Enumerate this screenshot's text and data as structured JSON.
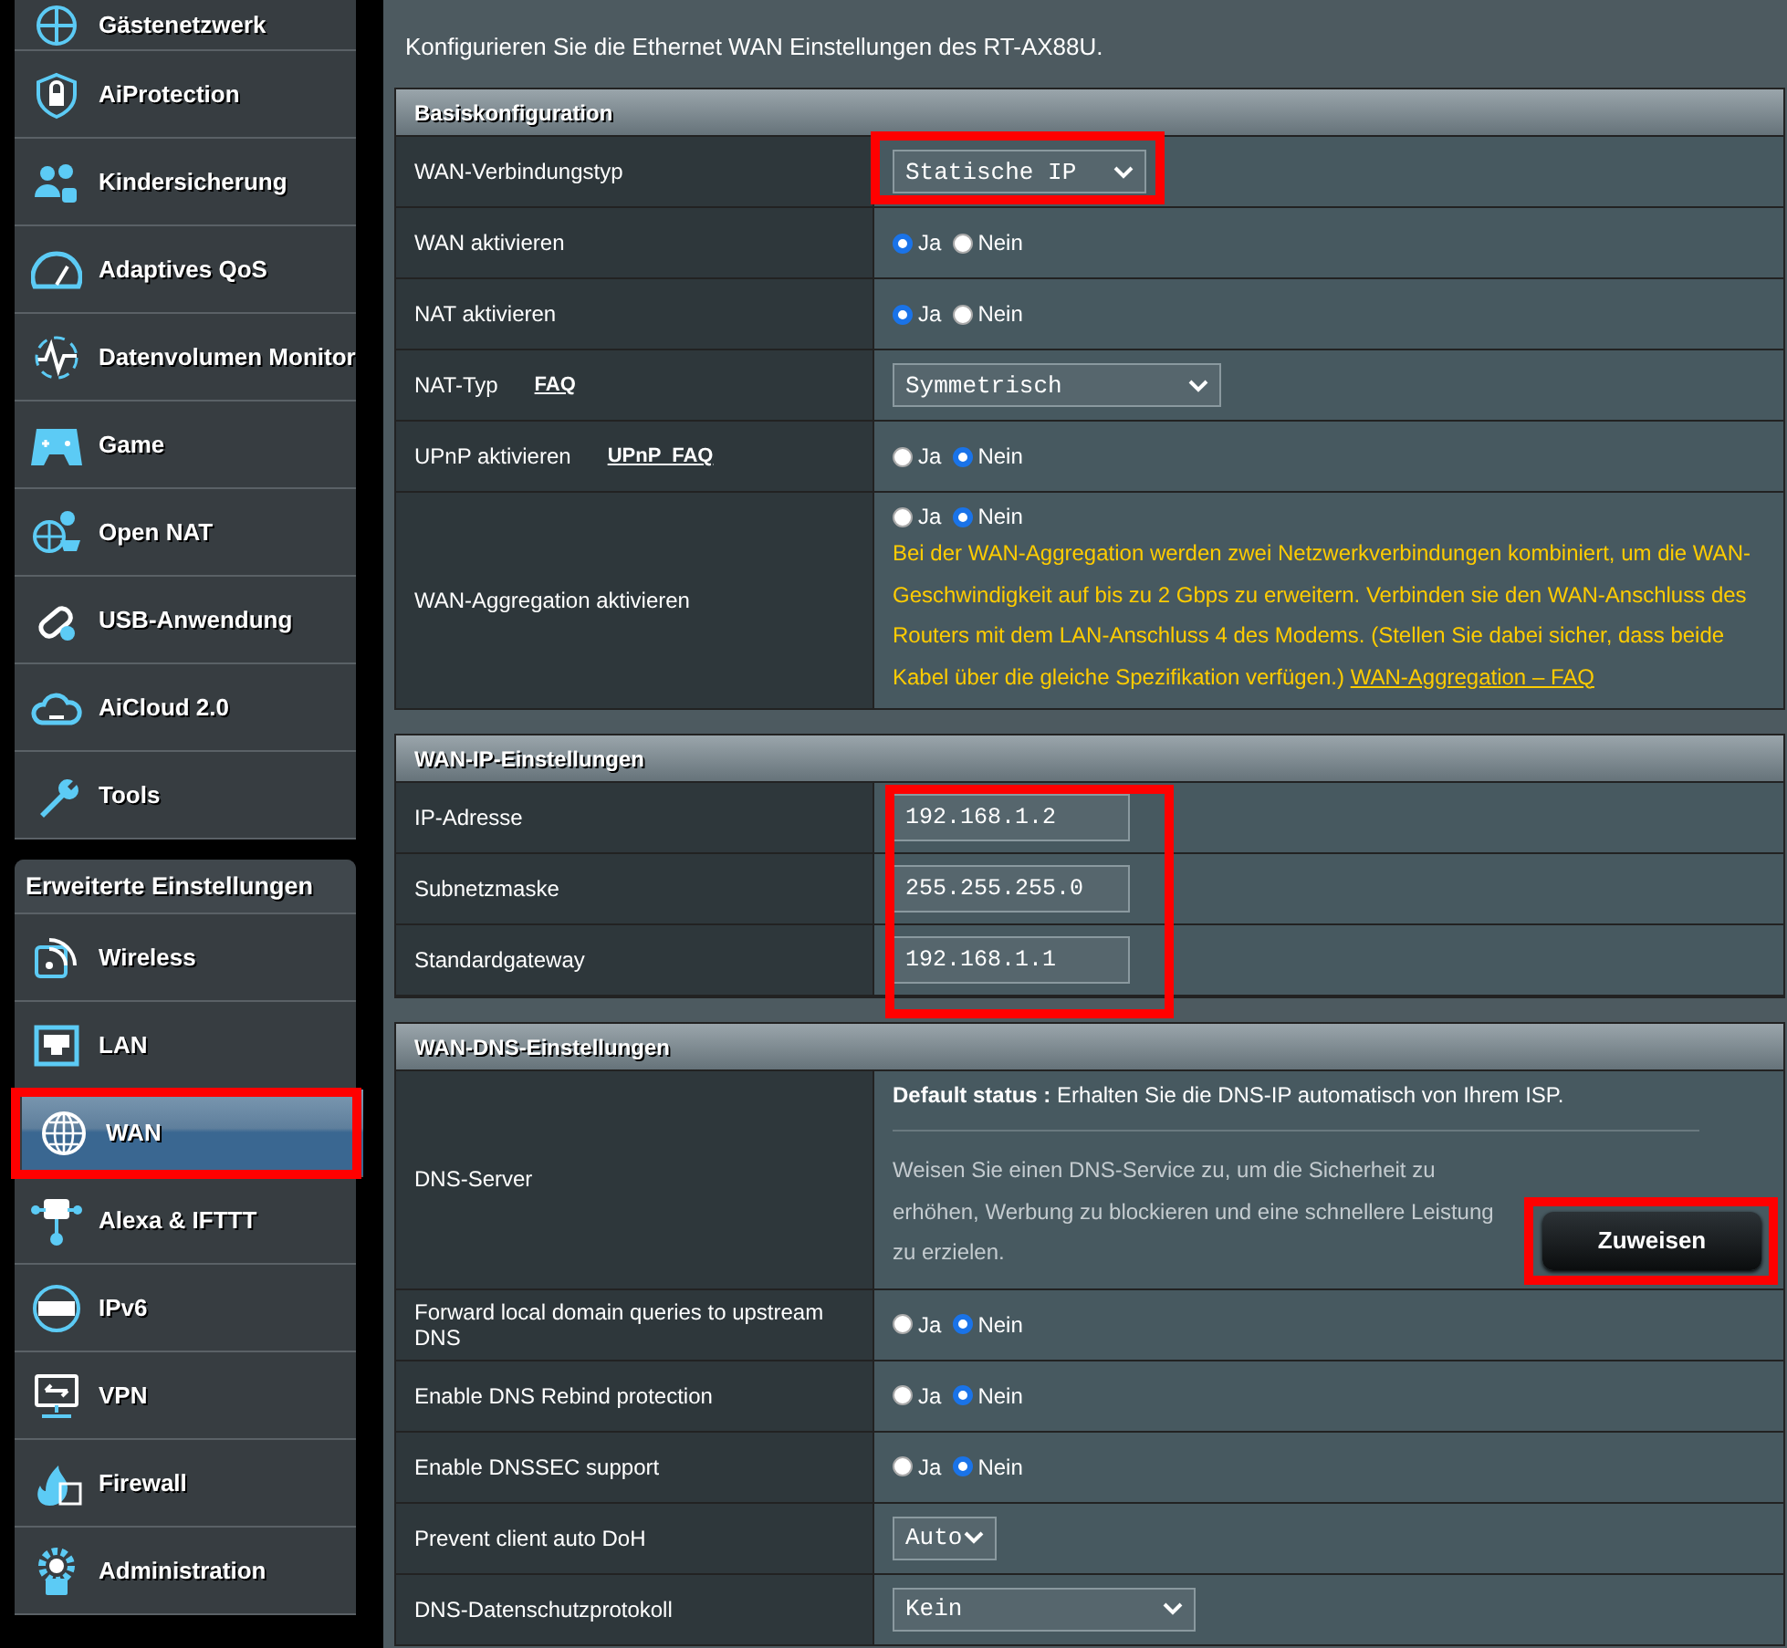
{
  "sidebar": {
    "items": [
      {
        "label": "Gästenetzwerk",
        "selected": false
      },
      {
        "label": "AiProtection",
        "selected": false
      },
      {
        "label": "Kindersicherung",
        "selected": false
      },
      {
        "label": "Adaptives QoS",
        "selected": false
      },
      {
        "label": "Datenvolumen Monitor",
        "selected": false
      },
      {
        "label": "Game",
        "selected": false
      },
      {
        "label": "Open NAT",
        "selected": false
      },
      {
        "label": "USB-Anwendung",
        "selected": false
      },
      {
        "label": "AiCloud 2.0",
        "selected": false
      },
      {
        "label": "Tools",
        "selected": false
      }
    ],
    "advanced_title": "Erweiterte Einstellungen",
    "advanced_items": [
      {
        "label": "Wireless",
        "selected": false,
        "highlighted": false
      },
      {
        "label": "LAN",
        "selected": false,
        "highlighted": false
      },
      {
        "label": "WAN",
        "selected": true,
        "highlighted": true
      },
      {
        "label": "Alexa & IFTTT",
        "selected": false,
        "highlighted": false
      },
      {
        "label": "IPv6",
        "selected": false,
        "highlighted": false
      },
      {
        "label": "VPN",
        "selected": false,
        "highlighted": false
      },
      {
        "label": "Firewall",
        "selected": false,
        "highlighted": false
      },
      {
        "label": "Administration",
        "selected": false,
        "highlighted": false
      }
    ]
  },
  "intro": "Konfigurieren Sie die Ethernet WAN Einstellungen des RT-AX88U.",
  "sections": [
    {
      "title": "Basiskonfiguration",
      "rows": [
        {
          "kind": "select",
          "label": "WAN-Verbindungstyp",
          "value": "Statische IP",
          "highlighted": true
        },
        {
          "kind": "radio",
          "label": "WAN aktivieren",
          "options": [
            {
              "label": "Ja",
              "selected": true
            },
            {
              "label": "Nein",
              "selected": false
            }
          ]
        },
        {
          "kind": "radio",
          "label": "NAT aktivieren",
          "options": [
            {
              "label": "Ja",
              "selected": true
            },
            {
              "label": "Nein",
              "selected": false
            }
          ]
        },
        {
          "kind": "select",
          "label": "NAT-Typ",
          "link": "FAQ",
          "value": "Symmetrisch"
        },
        {
          "kind": "radio",
          "label": "UPnP aktivieren",
          "link": "UPnP  FAQ",
          "options": [
            {
              "label": "Ja",
              "selected": false
            },
            {
              "label": "Nein",
              "selected": true
            }
          ]
        },
        {
          "kind": "radio",
          "label": "WAN-Aggregation aktivieren",
          "options": [
            {
              "label": "Ja",
              "selected": false
            },
            {
              "label": "Nein",
              "selected": true
            }
          ],
          "note": "Bei der WAN-Aggregation werden zwei Netzwerkverbindungen kombiniert, um die WAN-Geschwindigkeit auf bis zu 2 Gbps zu erweitern. Verbinden sie den WAN-Anschluss des Routers mit dem LAN-Anschluss 4 des Modems. (Stellen Sie dabei sicher, dass beide Kabel über die gleiche Spezifikation verfügen.)",
          "note_link": "WAN-Aggregation – FAQ"
        }
      ]
    },
    {
      "title": "WAN-IP-Einstellungen",
      "fields_highlighted": true,
      "rows": [
        {
          "kind": "field",
          "label": "IP-Adresse",
          "value": "192.168.1.2"
        },
        {
          "kind": "field",
          "label": "Subnetzmaske",
          "value": "255.255.255.0"
        },
        {
          "kind": "field",
          "label": "Standardgateway",
          "value": "192.168.1.1"
        }
      ]
    },
    {
      "title": "WAN-DNS-Einstellungen",
      "rows": [
        {
          "kind": "dns",
          "label": "DNS-Server",
          "status_label": "Default status :",
          "status_text": "Erhalten Sie die DNS-IP automatisch von Ihrem ISP.",
          "info": "Weisen Sie einen DNS-Service zu, um die Sicherheit zu erhöhen, Werbung zu blockieren und eine schnellere Leistung zu erzielen.",
          "button": "Zuweisen",
          "highlighted": true
        },
        {
          "kind": "radio",
          "label": "Forward local domain queries to upstream DNS",
          "options": [
            {
              "label": "Ja",
              "selected": false
            },
            {
              "label": "Nein",
              "selected": true
            }
          ]
        },
        {
          "kind": "radio",
          "label": "Enable DNS Rebind protection",
          "options": [
            {
              "label": "Ja",
              "selected": false
            },
            {
              "label": "Nein",
              "selected": true
            }
          ]
        },
        {
          "kind": "radio",
          "label": "Enable DNSSEC support",
          "options": [
            {
              "label": "Ja",
              "selected": false
            },
            {
              "label": "Nein",
              "selected": true
            }
          ]
        },
        {
          "kind": "small-select",
          "label": "Prevent client auto DoH",
          "value": "Auto"
        },
        {
          "kind": "select",
          "label": "DNS-Datenschutzprotokoll",
          "value": "Kein"
        }
      ]
    }
  ]
}
